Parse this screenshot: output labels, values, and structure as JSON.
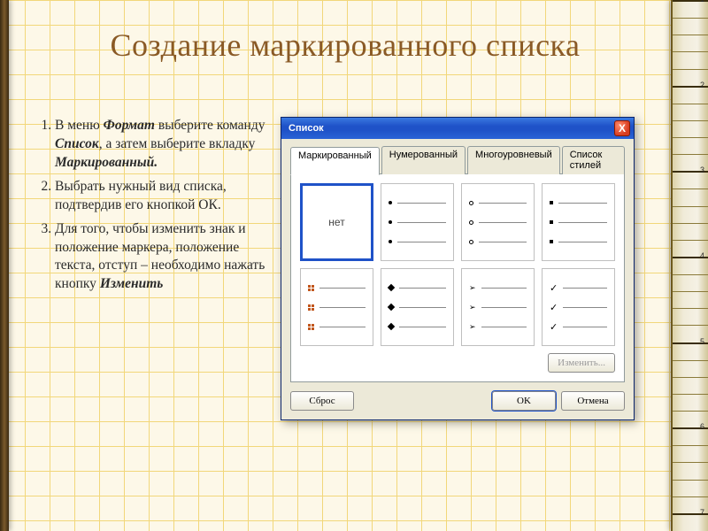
{
  "slide": {
    "title": "Создание маркированного списка"
  },
  "steps": {
    "s1_a": "В меню ",
    "s1_fmt": "Формат",
    "s1_b": " выберите команду ",
    "s1_list": "Список",
    "s1_c": ", а затем выберите вкладку ",
    "s1_mark": "Маркированный.",
    "s2_a": "Выбрать нужный вид списка, подтвердив его кнопкой ОК.",
    "s3_a": "Для того, чтобы изменить знак и положение маркера, положение текста, отступ – необходимо нажать кнопку ",
    "s3_btn": "Изменить"
  },
  "dialog": {
    "title": "Список",
    "tabs": {
      "bulleted": "Маркированный",
      "numbered": "Нумерованный",
      "outline": "Многоуровневый",
      "styles": "Список стилей"
    },
    "none": "нет",
    "buttons": {
      "modify": "Изменить...",
      "reset": "Сброс",
      "ok": "OK",
      "cancel": "Отмена"
    },
    "close_x": "X"
  }
}
